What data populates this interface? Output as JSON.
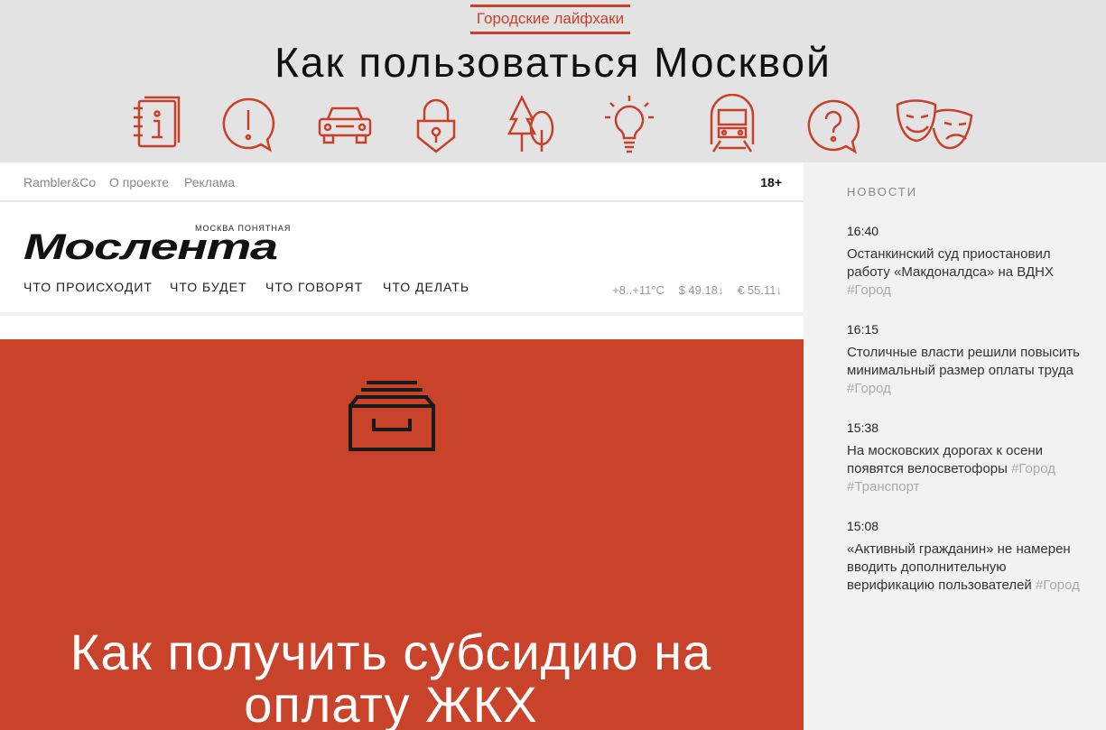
{
  "banner": {
    "kicker": "Городские лайфхаки",
    "title": "Как пользоваться Москвой",
    "icons": [
      "notebook-info-icon",
      "exclamation-bubble-icon",
      "car-icon",
      "padlock-icon",
      "trees-icon",
      "lightbulb-icon",
      "train-icon",
      "question-bubble-icon",
      "theater-masks-icon"
    ],
    "accent_color": "#c8402a"
  },
  "topbar": {
    "links": [
      "Rambler&Co",
      "О проекте",
      "Реклама"
    ],
    "age": "18+"
  },
  "logo": {
    "subtitle": "МОСКВА ПОНЯТНАЯ",
    "brand": "Мослента"
  },
  "nav": {
    "items": [
      "ЧТО ПРОИСХОДИТ",
      "ЧТО БУДЕТ",
      "ЧТО ГОВОРЯТ",
      "ЧТО ДЕЛАТЬ"
    ],
    "active_index": 3
  },
  "rates": {
    "weather": "+8..+11°C",
    "usd": "$ 49.18↓",
    "eur": "€ 55.11↓"
  },
  "hero": {
    "icon": "inbox-tray-icon",
    "title": "Как получить субсидию на оплату ЖКХ",
    "bg_color": "#c9432a"
  },
  "sidebar": {
    "heading": "НОВОСТИ",
    "news": [
      {
        "time": "16:40",
        "text": "Останкинский суд приостановил работу «Макдоналдса» на ВДНХ",
        "tags": "#Город"
      },
      {
        "time": "16:15",
        "text": "Столичные власти решили повысить минимальный размер оплаты труда",
        "tags": "#Город"
      },
      {
        "time": "15:38",
        "text": "На московских дорогах к осени появятся велосветофоры",
        "tags": "#Город #Транспорт"
      },
      {
        "time": "15:08",
        "text": "«Активный гражданин» не намерен вводить дополнительную верификацию пользователей",
        "tags": "#Город"
      }
    ]
  }
}
